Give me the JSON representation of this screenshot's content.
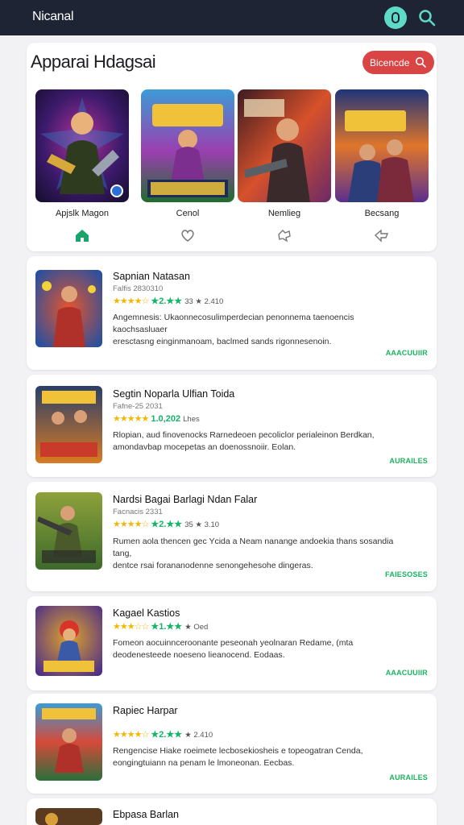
{
  "header": {
    "title": "Nicanal",
    "profile_icon": "profile-icon",
    "search_icon": "search-icon",
    "bg": "#1e2433",
    "accent": "#5fd9c8"
  },
  "featured": {
    "title": "Apparai Hdagsai",
    "browse_label": "Bicencde",
    "browse_color": "#d94444",
    "cards": [
      {
        "name": "Apjslk Magon",
        "icon": "home-icon",
        "art": "GAMIO",
        "theme": [
          "#3b1a6b",
          "#b4329a",
          "#2a8cd0"
        ]
      },
      {
        "name": "Cenol",
        "icon": "heart-icon",
        "art": "SAMUARR",
        "theme": [
          "#1f6d2d",
          "#3c9bd6",
          "#9b3fb0"
        ]
      },
      {
        "name": "Nemlieg",
        "icon": "bookmark-icon",
        "art": "STRIKE",
        "theme": [
          "#3c1b22",
          "#d7512b",
          "#6b2a66"
        ]
      },
      {
        "name": "Becsang",
        "icon": "share-icon",
        "art": "HOREIS",
        "theme": [
          "#20347a",
          "#e0762b",
          "#5b2f8e"
        ]
      }
    ]
  },
  "games": [
    {
      "title": "Sapnian Natasan",
      "meta": "Falfis 2830310",
      "stars": "★★★★☆",
      "score": "★2.★★",
      "extra": "33 ★ 2.410",
      "desc": [
        "Angemnesis: Ukaonnecosulimperdecian penonnema taenoencis kaochsasluaer",
        "eresctasng einginmanoam, baclmed sands rigonnesenoin."
      ],
      "action": "AAACUUIIR",
      "theme": [
        "#1a4fa8",
        "#e5552b"
      ]
    },
    {
      "title": "Segtin Noparla Ulfian Toida",
      "meta": "Fafne-25 2031",
      "stars": "★★★★★",
      "score": "1.0,202",
      "extra": "Lhes",
      "desc": [
        "Rlopian, aud finovenocks Rarnedeoen pecoliclor perialeinon Berdkan,",
        "amondavbap mocepetas an doenossnoiir. Eolan."
      ],
      "action": "AURAILES",
      "theme": [
        "#2a3f6b",
        "#d97b22"
      ]
    },
    {
      "title": "Nardsi Bagai Barlagi Ndan Falar",
      "meta": "Facnacis 2331",
      "stars": "★★★★☆",
      "score": "★2.★★",
      "extra": "35 ★ 3.10",
      "desc": [
        "Rumen aola thencen gec Ycida a Neam nanange andoekia thans sosandia tang,",
        "dentce rsai forananodenne senongehesohe dingeras."
      ],
      "action": "FAIESOSES",
      "theme": [
        "#3d6b2a",
        "#8ea13b"
      ]
    },
    {
      "title": "Kagael Kastios",
      "meta": "",
      "stars": "★★★☆☆",
      "score": "★1.★★",
      "extra": "★ Oed",
      "desc": [
        "Fomeon aocuinnceroonante peseonah yeolnaran Redame,  (mta",
        "deodenesteede noeseno lieanocend. Eodaas."
      ],
      "action": "AAACUUIIR",
      "theme": [
        "#4a2c8a",
        "#e0a22b"
      ]
    },
    {
      "title": "Rapiec Harpar",
      "meta": "",
      "stars": "★★★★☆",
      "score": "★2.★★",
      "extra": "★ 2.410",
      "desc": [
        "Rengencise Hiake roeimete lecbosekiosheis e topeogatran Cenda,",
        "eongingtuiann na penam le lmoneonan. Eecbas."
      ],
      "action": "AURAILES",
      "theme": [
        "#2b6f3b",
        "#d64a3a"
      ]
    },
    {
      "title": "Ebpasa Barlan",
      "meta": "",
      "stars": "",
      "score": "",
      "extra": "",
      "desc": [],
      "action": "",
      "theme": [
        "#5a3b1f",
        "#d9a03a"
      ]
    }
  ]
}
